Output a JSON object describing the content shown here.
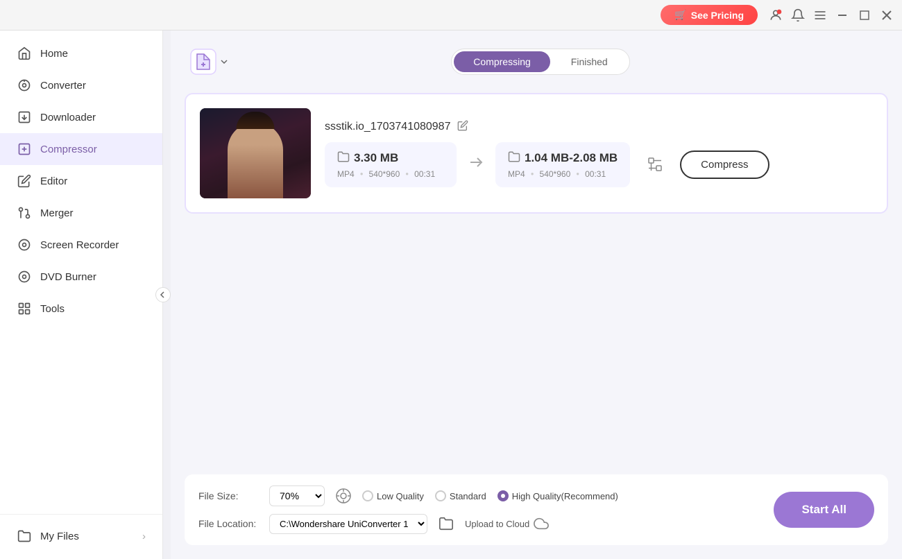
{
  "titlebar": {
    "see_pricing_label": "See Pricing",
    "see_pricing_icon": "🛒"
  },
  "sidebar": {
    "home_label": "Home",
    "items": [
      {
        "id": "converter",
        "label": "Converter",
        "icon": "converter"
      },
      {
        "id": "downloader",
        "label": "Downloader",
        "icon": "downloader"
      },
      {
        "id": "compressor",
        "label": "Compressor",
        "icon": "compressor",
        "active": true
      },
      {
        "id": "editor",
        "label": "Editor",
        "icon": "editor"
      },
      {
        "id": "merger",
        "label": "Merger",
        "icon": "merger"
      },
      {
        "id": "screen-recorder",
        "label": "Screen Recorder",
        "icon": "screen-recorder"
      },
      {
        "id": "dvd-burner",
        "label": "DVD Burner",
        "icon": "dvd-burner"
      },
      {
        "id": "tools",
        "label": "Tools",
        "icon": "tools"
      }
    ],
    "my_files_label": "My Files"
  },
  "content": {
    "tabs": [
      {
        "id": "compressing",
        "label": "Compressing",
        "active": true
      },
      {
        "id": "finished",
        "label": "Finished",
        "active": false
      }
    ],
    "file": {
      "name": "ssstik.io_1703741080987",
      "source_size": "3.30 MB",
      "source_format": "MP4",
      "source_resolution": "540*960",
      "source_duration": "00:31",
      "target_size": "1.04 MB-2.08 MB",
      "target_format": "MP4",
      "target_resolution": "540*960",
      "target_duration": "00:31",
      "compress_btn_label": "Compress"
    },
    "bottom": {
      "file_size_label": "File Size:",
      "file_size_value": "70%",
      "file_location_label": "File Location:",
      "file_location_value": "C:\\Wondershare UniConverter 1",
      "upload_cloud_label": "Upload to Cloud",
      "start_all_label": "Start All",
      "quality_options": [
        {
          "id": "low",
          "label": "Low Quality",
          "selected": false
        },
        {
          "id": "standard",
          "label": "Standard",
          "selected": false
        },
        {
          "id": "high",
          "label": "High Quality(Recommend)",
          "selected": true
        }
      ]
    }
  }
}
